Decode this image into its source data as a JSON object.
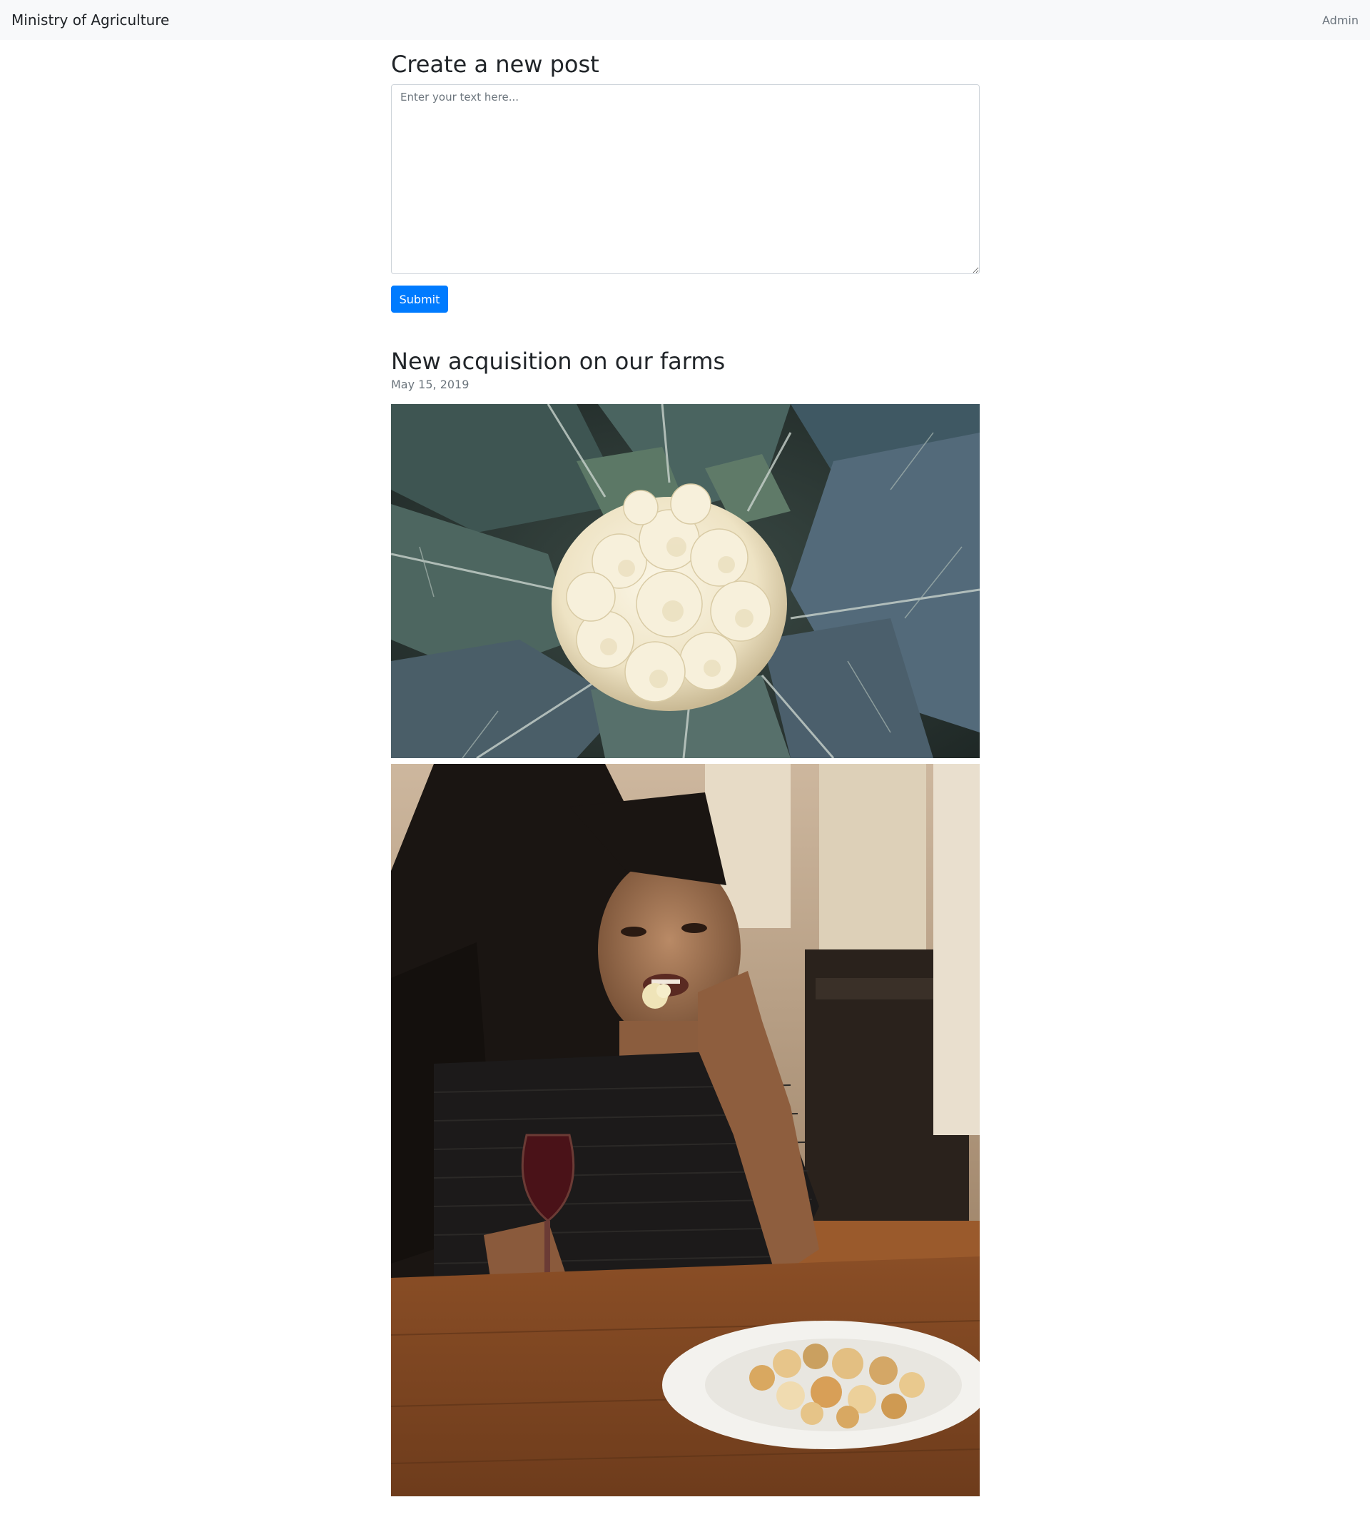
{
  "navbar": {
    "brand": "Ministry of Agriculture",
    "admin_link": "Admin"
  },
  "composer": {
    "title": "Create a new post",
    "textarea_placeholder": "Enter your text here...",
    "submit_label": "Submit"
  },
  "post": {
    "title": "New acquisition on our farms",
    "date": "May 15, 2019"
  },
  "colors": {
    "navbar_bg": "#f8f9fa",
    "primary": "#007bff",
    "muted_text": "#6c757d"
  }
}
